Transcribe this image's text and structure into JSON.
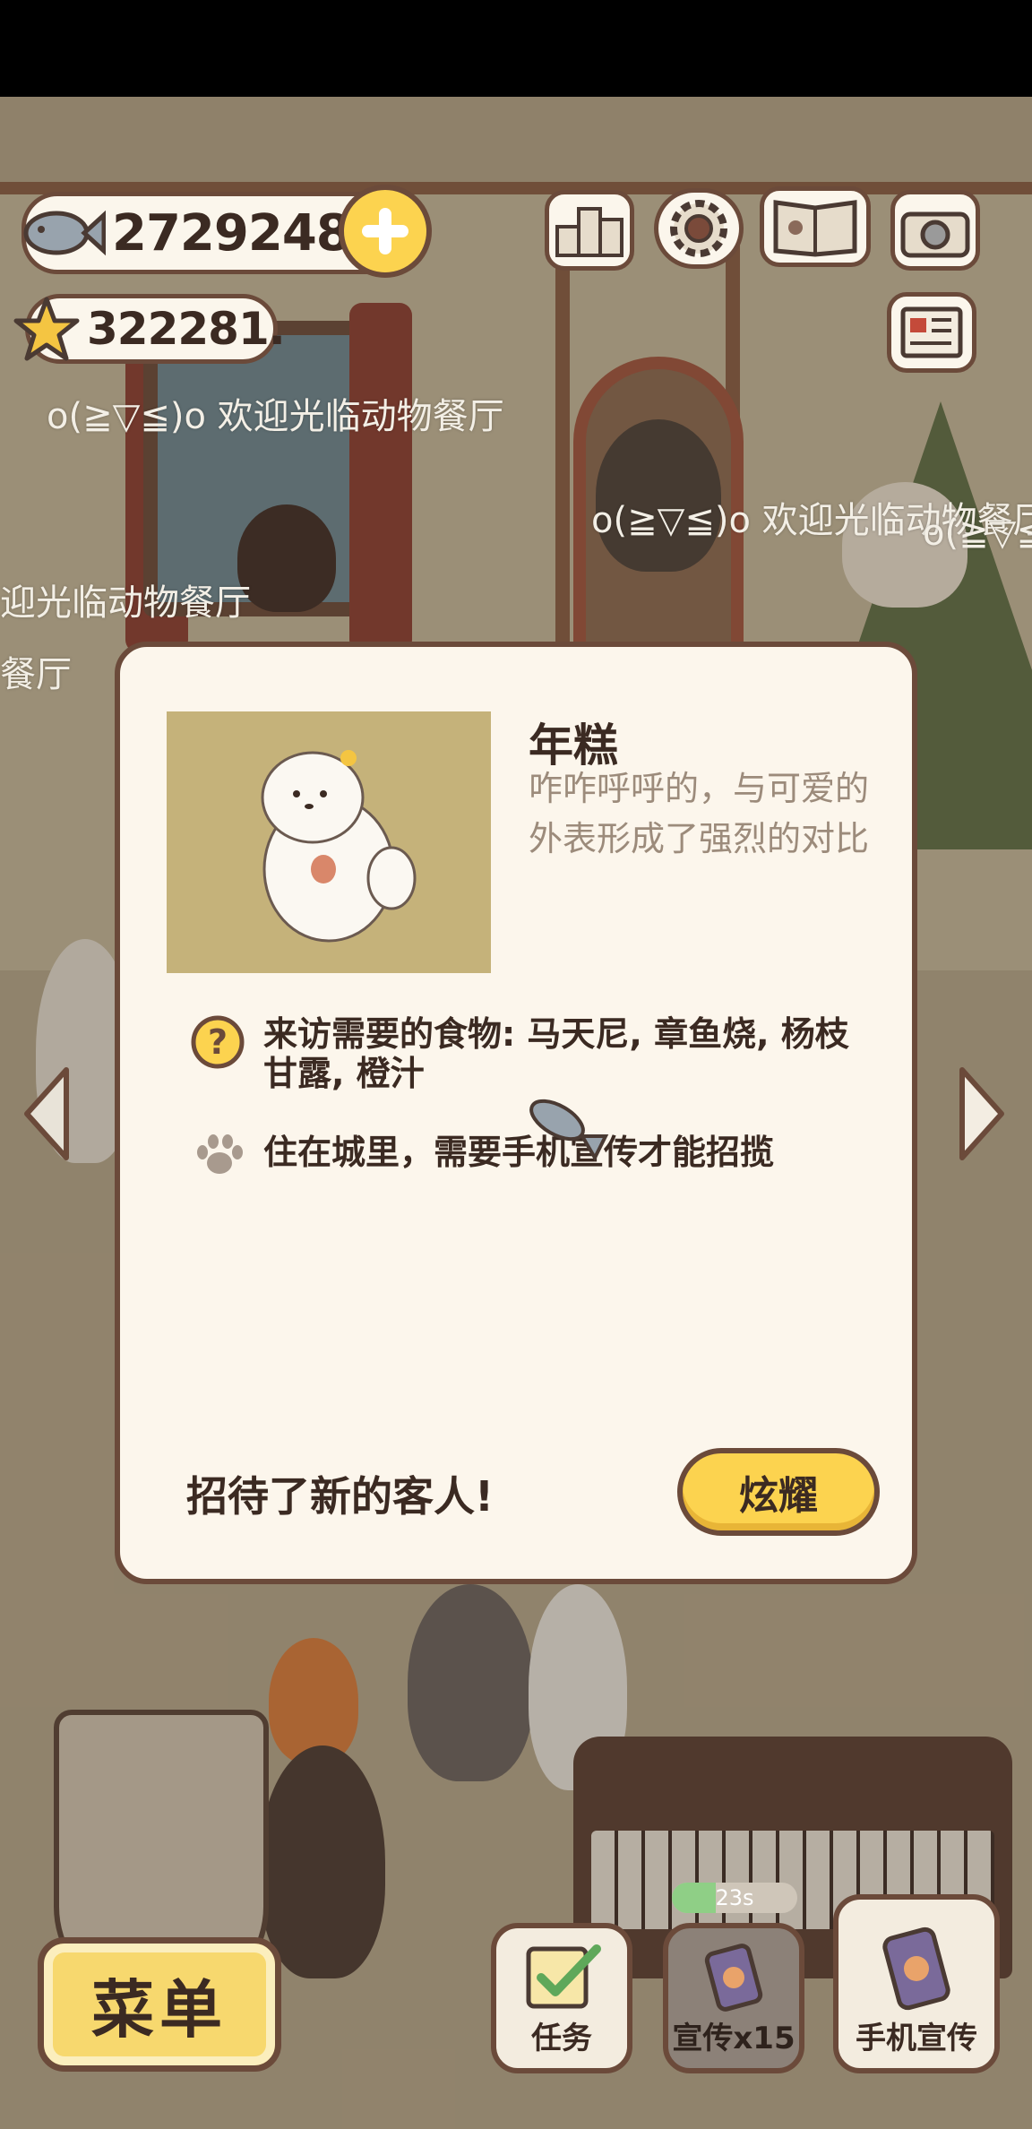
{
  "hud": {
    "fish_coins": "27292480",
    "stars": "322281.",
    "icons": [
      "fish-icon",
      "plus-icon",
      "star-icon",
      "ranking-icon",
      "settings-gear-icon",
      "guidebook-icon",
      "camera-icon",
      "newspaper-icon"
    ]
  },
  "scroll_messages": [
    "o(≧▽≦)o 欢迎光临动物餐厅",
    "o(≧▽≦)o 欢迎光临动物餐厅",
    "迎光临动物餐厅",
    "餐厅",
    "o(≧▽≦"
  ],
  "dialog": {
    "customer_name": "年糕",
    "description": "咋咋呼呼的，与可爱的外表形成了强烈的对比",
    "requirement_food": "来访需要的食物: 马天尼, 章鱼烧, 杨枝甘露, 橙汁",
    "requirement_location": "住在城里，需要手机宣传才能招揽",
    "footer_message": "招待了新的客人!",
    "show_button": "炫耀"
  },
  "bottom_bar": {
    "menu": "菜单",
    "tasks": "任务",
    "promote": "宣传x15",
    "phone_promote": "手机宣传",
    "timer": "23s",
    "timer_progress": 0.35
  },
  "colors": {
    "outline": "#6b4a3a",
    "button_yellow": "#fcd34f",
    "dialog_bg": "#fcf6ec",
    "portrait_bg": "#c5b27a",
    "desc_text": "#9c8b7b"
  }
}
